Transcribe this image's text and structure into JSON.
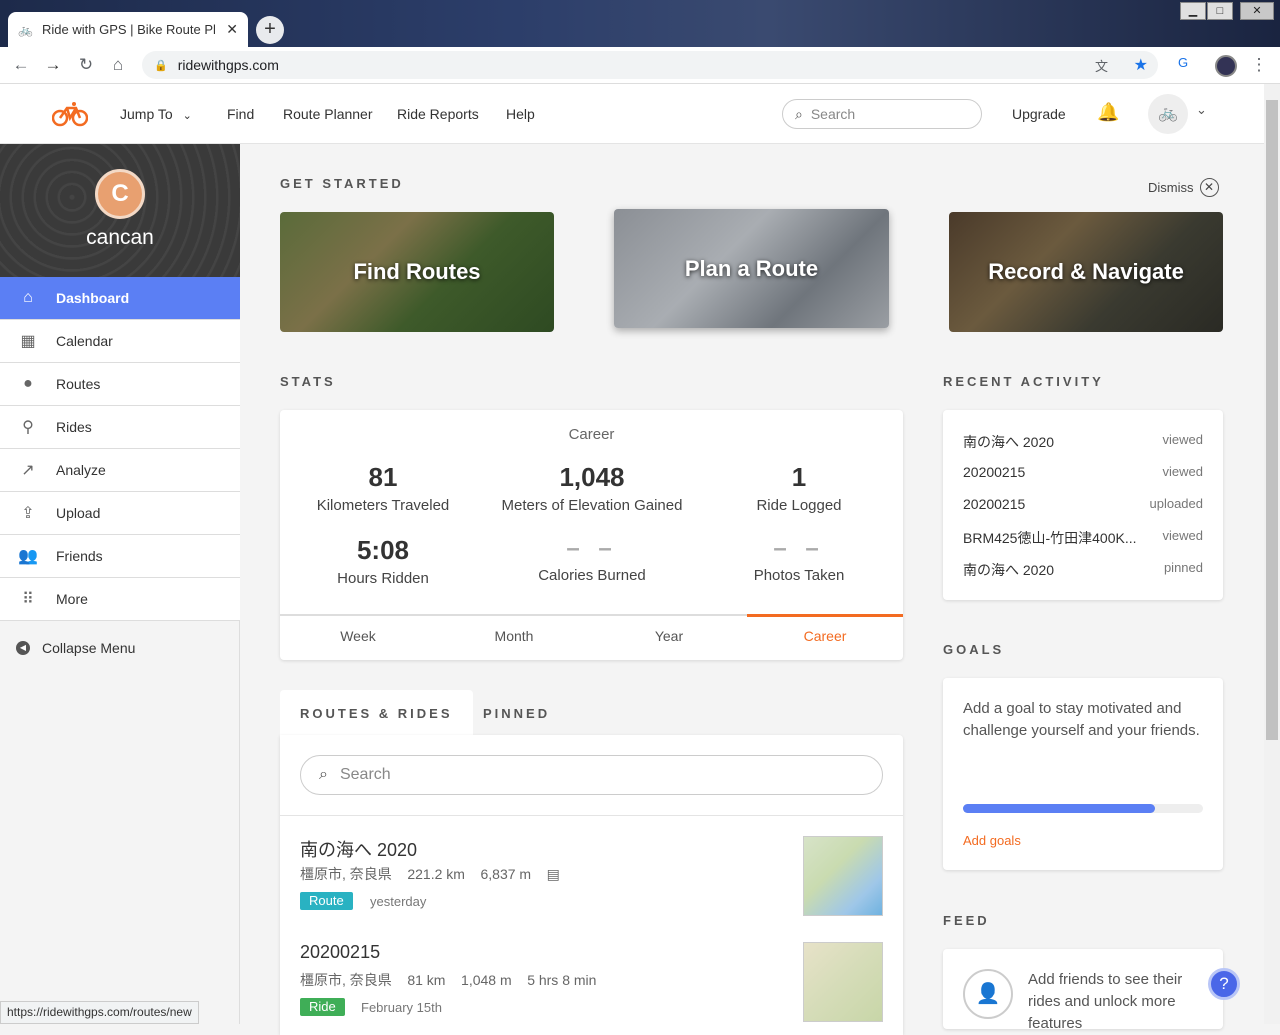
{
  "browser": {
    "tab_title": "Ride with GPS | Bike Route Pl",
    "url": "ridewithgps.com",
    "status_url": "https://ridewithgps.com/routes/new"
  },
  "header": {
    "nav": [
      "Jump To",
      "Find",
      "Route Planner",
      "Ride Reports",
      "Help"
    ],
    "search_placeholder": "Search",
    "upgrade": "Upgrade"
  },
  "sidebar": {
    "avatar_letter": "C",
    "username": "cancan",
    "items": [
      {
        "label": "Dashboard",
        "icon": "home-icon"
      },
      {
        "label": "Calendar",
        "icon": "calendar-icon"
      },
      {
        "label": "Routes",
        "icon": "map-pin-icon"
      },
      {
        "label": "Rides",
        "icon": "bike-icon"
      },
      {
        "label": "Analyze",
        "icon": "trend-icon"
      },
      {
        "label": "Upload",
        "icon": "upload-icon"
      },
      {
        "label": "Friends",
        "icon": "friends-icon"
      },
      {
        "label": "More",
        "icon": "grid-icon"
      }
    ],
    "collapse": "Collapse Menu"
  },
  "get_started": {
    "title": "GET STARTED",
    "dismiss": "Dismiss",
    "cards": [
      "Find Routes",
      "Plan a Route",
      "Record & Navigate"
    ]
  },
  "stats": {
    "title": "STATS",
    "period_label": "Career",
    "items": [
      {
        "value": "81",
        "label": "Kilometers Traveled"
      },
      {
        "value": "1,048",
        "label": "Meters of Elevation Gained"
      },
      {
        "value": "1",
        "label": "Ride Logged"
      },
      {
        "value": "5:08",
        "label": "Hours Ridden"
      },
      {
        "value": "– –",
        "label": "Calories Burned"
      },
      {
        "value": "– –",
        "label": "Photos Taken"
      }
    ],
    "tabs": [
      "Week",
      "Month",
      "Year",
      "Career"
    ],
    "active_tab": "Career"
  },
  "recent_activity": {
    "title": "RECENT ACTIVITY",
    "items": [
      {
        "name": "南の海へ 2020",
        "action": "viewed"
      },
      {
        "name": "20200215",
        "action": "viewed"
      },
      {
        "name": "20200215",
        "action": "uploaded"
      },
      {
        "name": "BRM425徳山-竹田津400K...",
        "action": "viewed"
      },
      {
        "name": "南の海へ 2020",
        "action": "pinned"
      }
    ]
  },
  "goals": {
    "title": "GOALS",
    "text": "Add a goal to stay motivated and challenge yourself and your friends.",
    "progress": 0.8,
    "link": "Add goals"
  },
  "feed": {
    "title": "FEED",
    "text": "Add friends to see their rides and unlock more features"
  },
  "routes_rides": {
    "tabs": [
      "ROUTES & RIDES",
      "PINNED"
    ],
    "search_placeholder": "Search",
    "items": [
      {
        "title": "南の海へ 2020",
        "location": "橿原市, 奈良県",
        "distance": "221.2 km",
        "elevation": "6,837 m",
        "duration": "",
        "type": "Route",
        "when": "yesterday"
      },
      {
        "title": "20200215",
        "location": "橿原市, 奈良県",
        "distance": "81 km",
        "elevation": "1,048 m",
        "duration": "5 hrs 8 min",
        "type": "Ride",
        "when": "February 15th"
      }
    ]
  },
  "colors": {
    "accent": "#f36b21",
    "sidebar_active": "#5b7ff4",
    "route_badge": "#29b2c2",
    "ride_badge": "#3fae57"
  }
}
